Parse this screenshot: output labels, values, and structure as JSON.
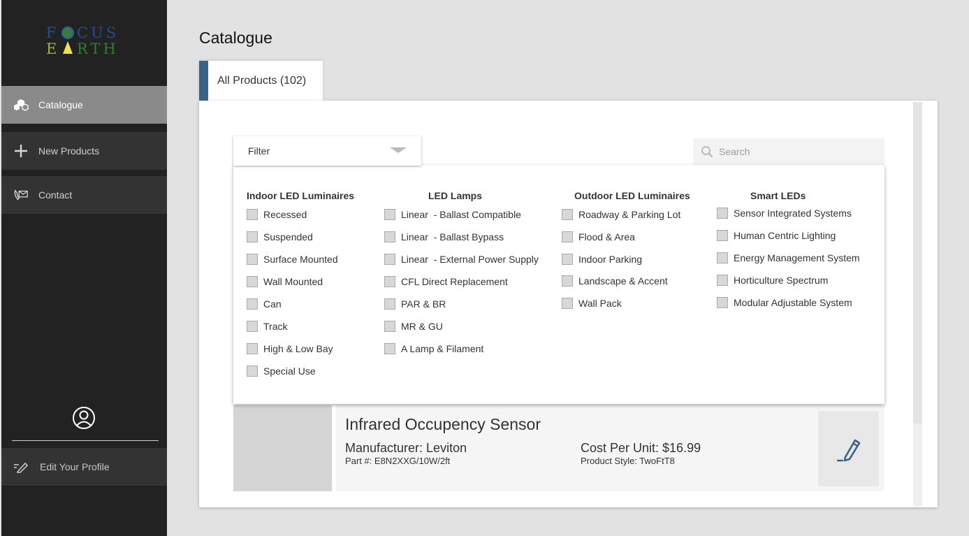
{
  "brand": {
    "logo_top": "FOCUS",
    "logo_bottom": "EARTH"
  },
  "sidebar": {
    "items": [
      {
        "label": "Catalogue",
        "icon": "cubes-icon",
        "active": true
      },
      {
        "label": "New Products",
        "icon": "plus-icon",
        "active": false
      },
      {
        "label": "Contact",
        "icon": "phone-mail-icon",
        "active": false
      }
    ],
    "edit_profile": "Edit Your Profile"
  },
  "page": {
    "title": "Catalogue",
    "tab_label": "All Products (102)"
  },
  "filter": {
    "label": "Filter"
  },
  "search": {
    "placeholder": "Search"
  },
  "filter_groups": [
    {
      "heading": "Indoor LED Luminaires",
      "options": [
        "Recessed",
        "Suspended",
        "Surface Mounted",
        "Wall Mounted",
        "Can",
        "Track",
        "High & Low Bay",
        "Special Use"
      ]
    },
    {
      "heading": "LED Lamps",
      "options": [
        "Linear  - Ballast Compatible",
        "Linear  - Ballast Bypass",
        "Linear  - External Power Supply",
        "CFL Direct Replacement",
        "PAR & BR",
        "MR & GU",
        "A Lamp & Filament"
      ]
    },
    {
      "heading": "Outdoor LED Luminaires",
      "options": [
        "Roadway & Parking Lot",
        "Flood & Area",
        "Indoor Parking",
        "Landscape & Accent",
        "Wall Pack"
      ]
    },
    {
      "heading": "Smart LEDs",
      "options": [
        "Sensor Integrated Systems",
        "Human Centric Lighting",
        "Energy Management System",
        "Horticulture Spectrum",
        "Modular Adjustable System"
      ]
    }
  ],
  "product": {
    "name": "Infrared Occupency Sensor",
    "manufacturer": "Manufacturer: Leviton",
    "part": "Part #: E8N2XXG/10W/2ft",
    "cost": "Cost Per Unit: $16.99",
    "style": "Product Style: TwoFtT8"
  },
  "colors": {
    "accent": "#3a6389",
    "sidebar_bg": "#222222",
    "active_item": "#8a8a8a"
  }
}
